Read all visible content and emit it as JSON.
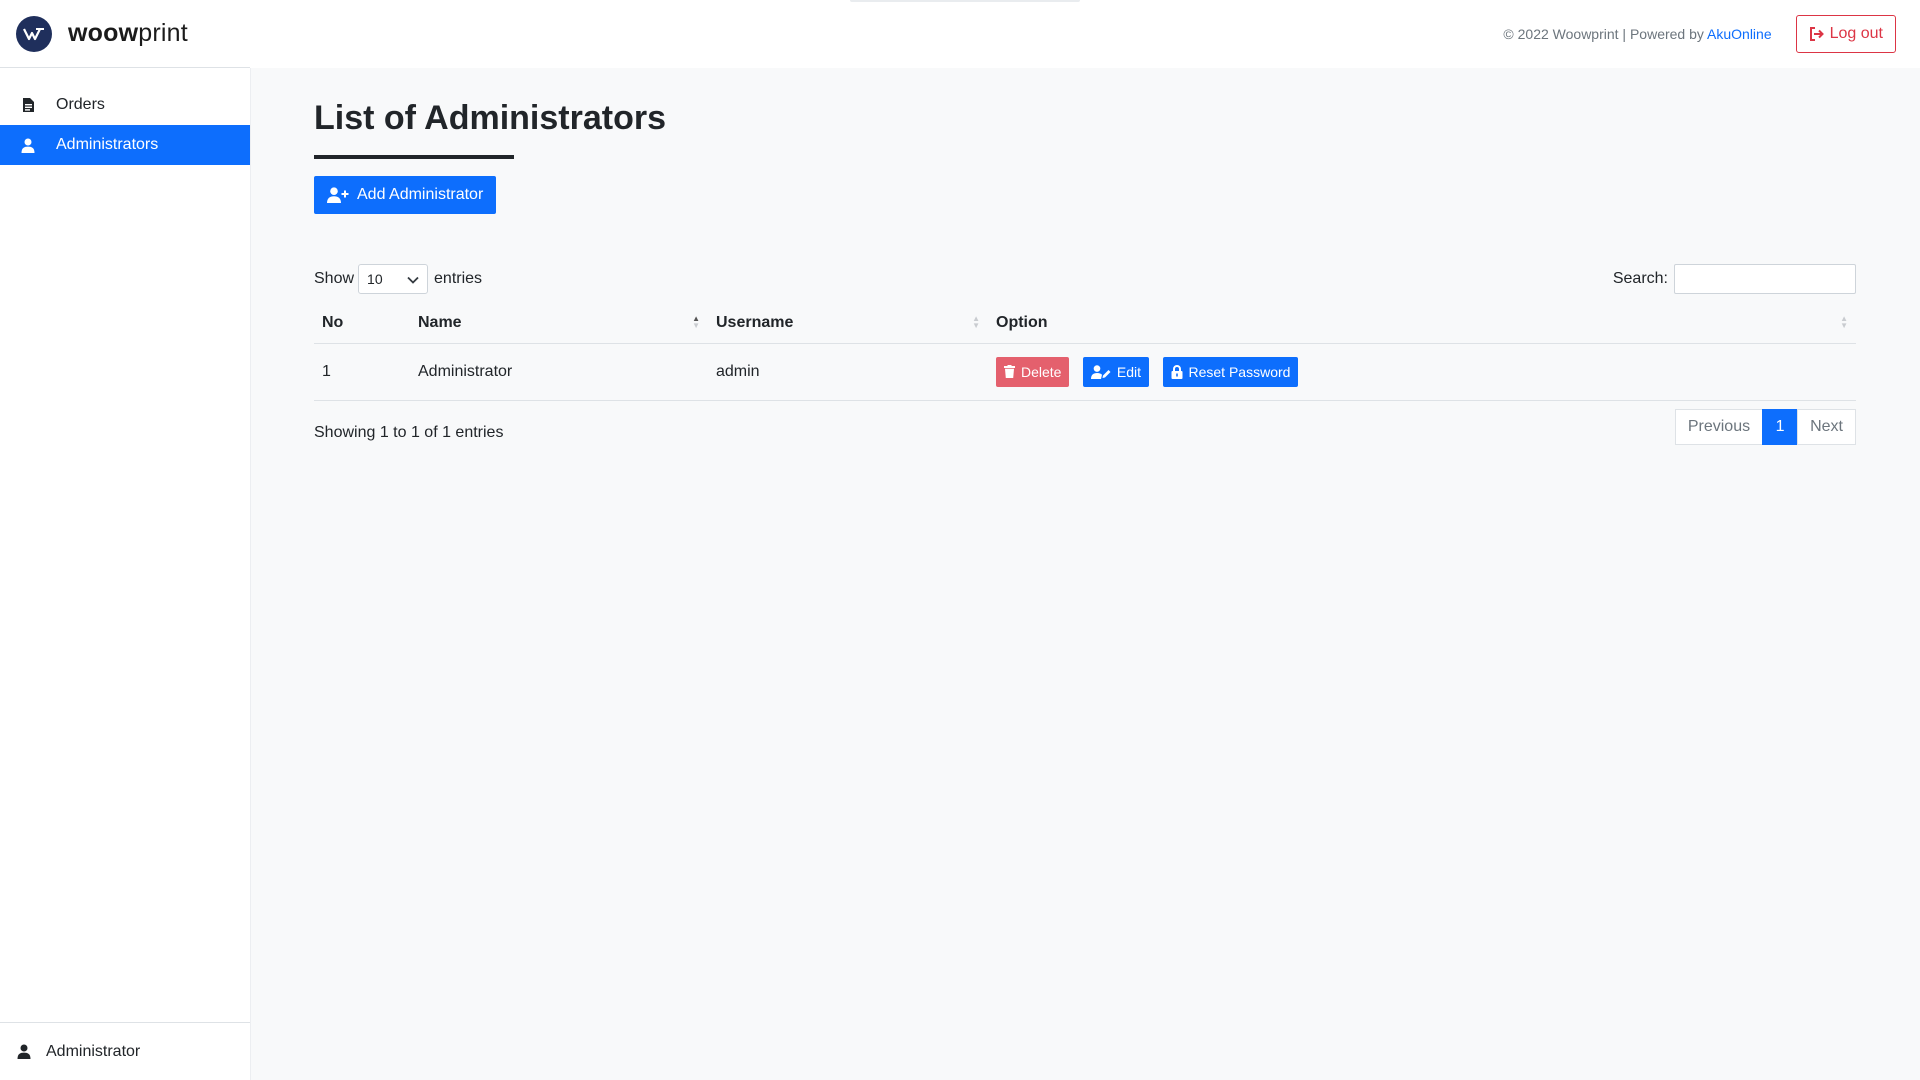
{
  "brand": {
    "name_bold": "woow",
    "name_light": "print"
  },
  "sidebar": {
    "items": [
      {
        "label": "Orders",
        "icon": "file-icon",
        "active": false
      },
      {
        "label": "Administrators",
        "icon": "user-icon",
        "active": true
      }
    ],
    "footer_user": "Administrator"
  },
  "topbar": {
    "copyright": "© 2022 Woowprint | Powered by ",
    "powered_link": "AkuOnline",
    "logout_label": "Log out"
  },
  "page": {
    "title": "List of Administrators",
    "add_button": "Add Administrator"
  },
  "table_controls": {
    "show_label": "Show",
    "entries_value": "10",
    "entries_label": "entries",
    "search_label": "Search:"
  },
  "table": {
    "columns": [
      "No",
      "Name",
      "Username",
      "Option"
    ],
    "rows": [
      {
        "no": "1",
        "name": "Administrator",
        "username": "admin"
      }
    ],
    "actions": {
      "delete": "Delete",
      "edit": "Edit",
      "reset": "Reset Password"
    }
  },
  "footer": {
    "info": "Showing 1 to 1 of 1 entries",
    "pagination": {
      "previous": "Previous",
      "current": "1",
      "next": "Next"
    }
  },
  "colors": {
    "primary": "#0d6efd",
    "danger": "#dc3545",
    "delete_button": "#e4606d",
    "logo_bg": "#1f2f5c"
  }
}
